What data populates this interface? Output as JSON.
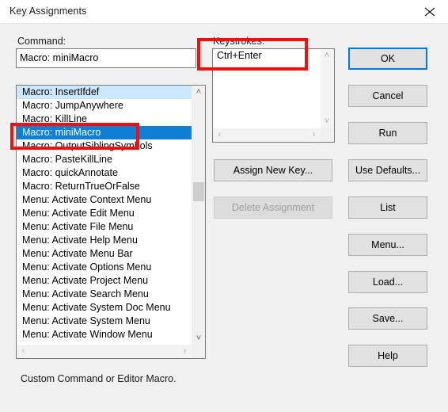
{
  "window": {
    "title": "Key Assignments",
    "close_icon": "close-icon"
  },
  "command_section": {
    "label": "Command:",
    "input_value": "Macro: miniMacro",
    "input_placeholder": "",
    "items": [
      {
        "label": "Macro: InsertIfdef",
        "state": "hot"
      },
      {
        "label": "Macro: JumpAnywhere",
        "state": "normal"
      },
      {
        "label": "Macro: KillLine",
        "state": "normal"
      },
      {
        "label": "Macro: miniMacro",
        "state": "selected"
      },
      {
        "label": "Macro: OutputSiblingSymbols",
        "state": "normal"
      },
      {
        "label": "Macro: PasteKillLine",
        "state": "normal"
      },
      {
        "label": "Macro: quickAnnotate",
        "state": "normal"
      },
      {
        "label": "Macro: ReturnTrueOrFalse",
        "state": "normal"
      },
      {
        "label": "Menu: Activate Context Menu",
        "state": "normal"
      },
      {
        "label": "Menu: Activate Edit Menu",
        "state": "normal"
      },
      {
        "label": "Menu: Activate File Menu",
        "state": "normal"
      },
      {
        "label": "Menu: Activate Help Menu",
        "state": "normal"
      },
      {
        "label": "Menu: Activate Menu Bar",
        "state": "normal"
      },
      {
        "label": "Menu: Activate Options Menu",
        "state": "normal"
      },
      {
        "label": "Menu: Activate Project Menu",
        "state": "normal"
      },
      {
        "label": "Menu: Activate Search Menu",
        "state": "normal"
      },
      {
        "label": "Menu: Activate System Doc Menu",
        "state": "normal"
      },
      {
        "label": "Menu: Activate System Menu",
        "state": "normal"
      },
      {
        "label": "Menu: Activate Window Menu",
        "state": "normal"
      }
    ],
    "scrollbar": {
      "up_glyph": "˄",
      "down_glyph": "˅",
      "left_glyph": "‹",
      "right_glyph": "›"
    }
  },
  "keystrokes_section": {
    "label": "Keystrokes:",
    "items": [
      {
        "label": "Ctrl+Enter"
      }
    ],
    "scrollbar": {
      "up_glyph": "˄",
      "down_glyph": "˅",
      "left_glyph": "‹",
      "right_glyph": "›"
    }
  },
  "middle_buttons": {
    "assign_new_key": "Assign New Key...",
    "delete_assignment": "Delete Assignment"
  },
  "right_buttons": {
    "ok": "OK",
    "cancel": "Cancel",
    "run": "Run",
    "use_defaults": "Use Defaults...",
    "list": "List",
    "menu": "Menu...",
    "load": "Load...",
    "save": "Save...",
    "help": "Help"
  },
  "status": {
    "text": "Custom Command or Editor Macro."
  },
  "colors": {
    "dialog_background": "#f0f0f0",
    "titlebar_background": "#ffffff",
    "selection_blue": "#0e7fd4",
    "hot_item_blue": "#cce8ff",
    "focus_border": "#0078d7",
    "button_face": "#e1e1e1",
    "annotation_red": "#f40f0f",
    "disabled_text": "#9d9d9d"
  },
  "annotations": [
    {
      "name": "keystrokes-highlight",
      "target": "Ctrl+Enter"
    },
    {
      "name": "selected-command-highlight",
      "target": "Macro: miniMacro"
    }
  ]
}
